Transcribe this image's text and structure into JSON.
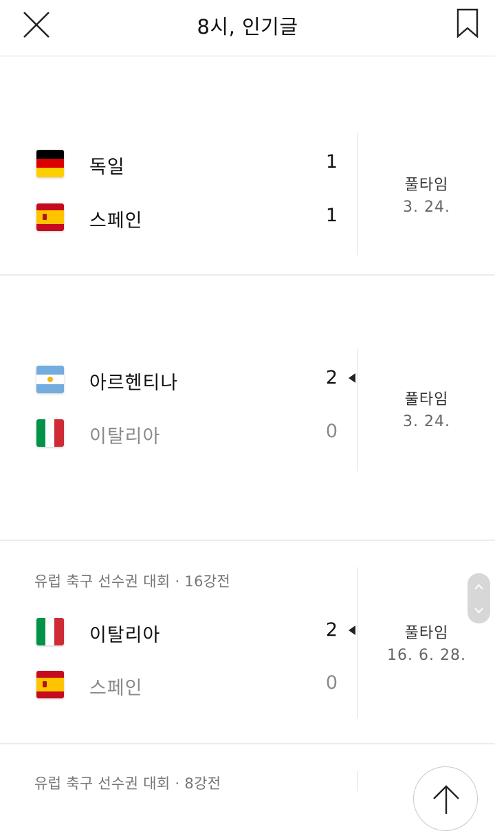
{
  "header": {
    "title": "8시, 인기글",
    "close_icon": "close-icon",
    "bookmark_icon": "bookmark-icon"
  },
  "matches": [
    {
      "competition": "",
      "home": {
        "team": "독일",
        "score": "1",
        "flag": "germany"
      },
      "away": {
        "team": "스페인",
        "score": "1",
        "flag": "spain"
      },
      "status": "풀타임",
      "date": "3. 24."
    },
    {
      "competition": "",
      "home": {
        "team": "아르헨티나",
        "score": "2",
        "flag": "argentina",
        "winner": true
      },
      "away": {
        "team": "이탈리아",
        "score": "0",
        "flag": "italy"
      },
      "status": "풀타임",
      "date": "3. 24."
    },
    {
      "competition": "유럽 축구 선수권 대회 · 16강전",
      "home": {
        "team": "이탈리아",
        "score": "2",
        "flag": "italy",
        "winner": true
      },
      "away": {
        "team": "스페인",
        "score": "0",
        "flag": "spain"
      },
      "status": "풀타임",
      "date": "16. 6. 28."
    },
    {
      "competition": "유럽 축구 선수권 대회 · 8강전"
    }
  ],
  "controls": {
    "scroll_icon": "scroll-up-down-icon",
    "top_icon": "arrow-up-icon"
  },
  "colors": {
    "germany_black": "#000000",
    "germany_red": "#DD0000",
    "germany_gold": "#FFCE00",
    "spain_red": "#C60B1E",
    "spain_yellow": "#FFC400",
    "argentina_blue": "#74ACDF",
    "argentina_sun": "#F6B40E",
    "italy_green": "#009246",
    "italy_red": "#CE2B37"
  }
}
